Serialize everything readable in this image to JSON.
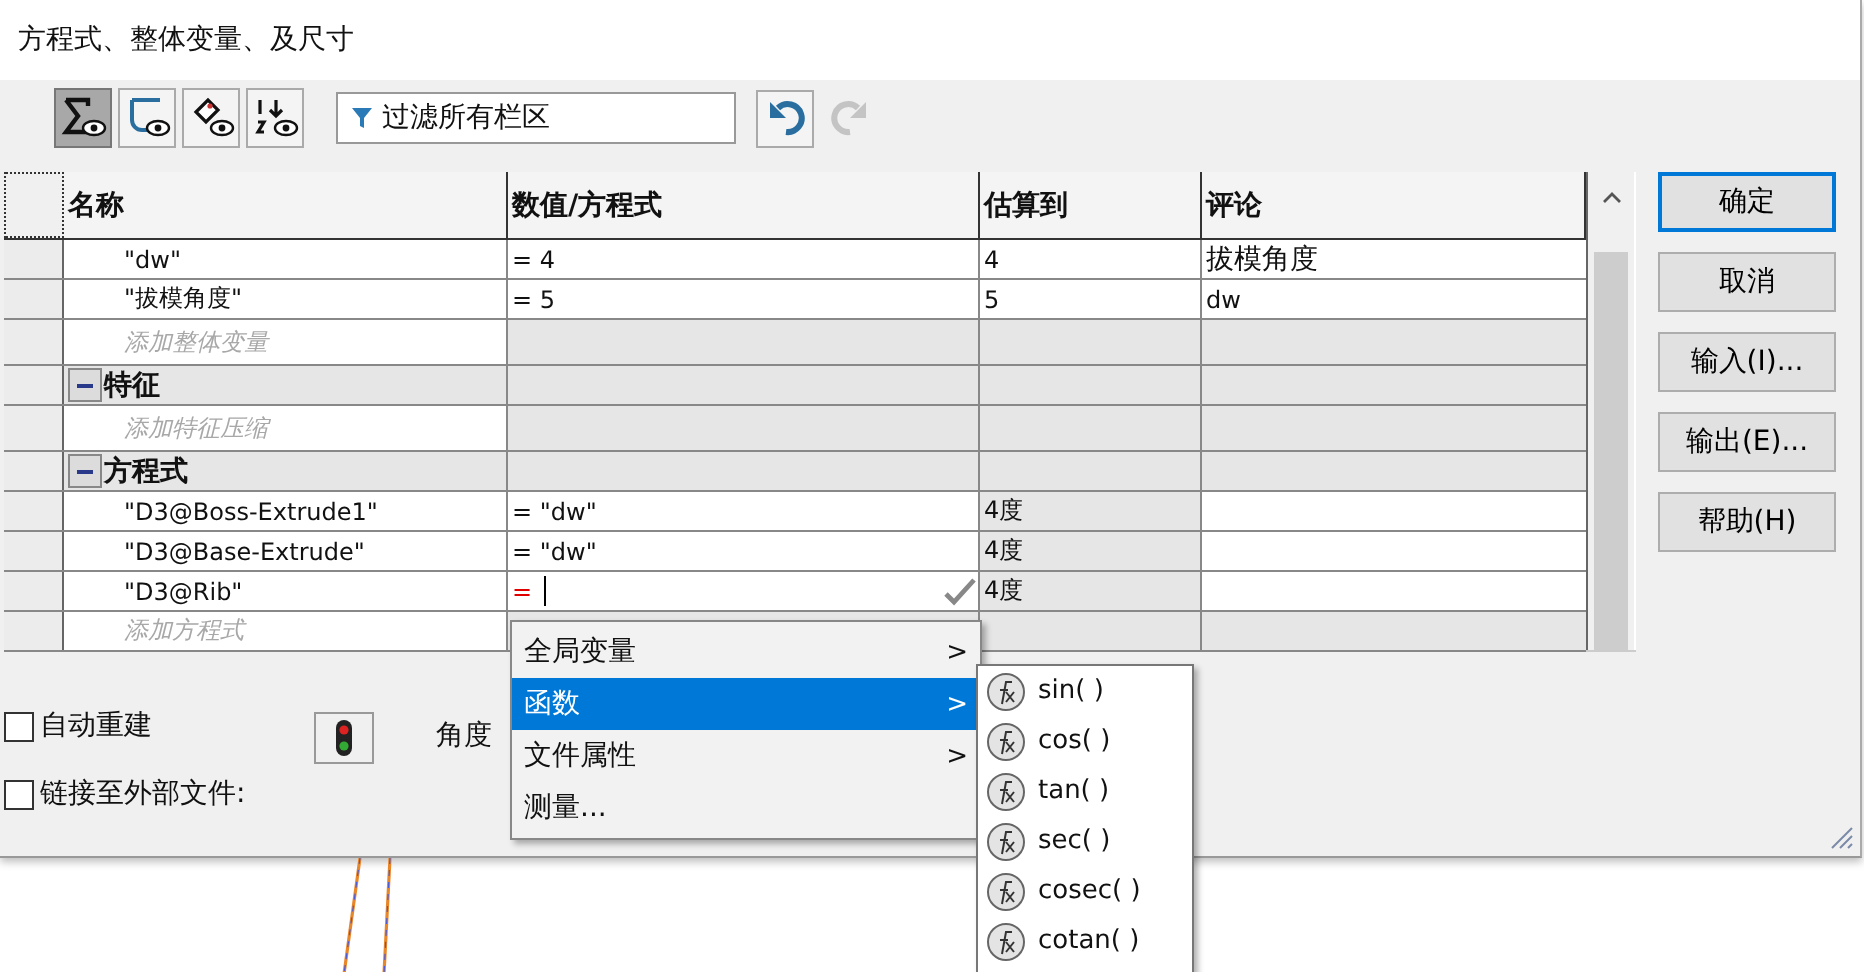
{
  "window": {
    "title": "方程式、整体变量、及尺寸"
  },
  "toolbar": {
    "view_buttons": [
      {
        "kind": "sum",
        "selected": true
      },
      {
        "kind": "sketch",
        "selected": false
      },
      {
        "kind": "tag",
        "selected": false
      },
      {
        "kind": "order",
        "selected": false
      }
    ],
    "filter": {
      "placeholder": "过滤所有栏区"
    },
    "undo_enabled": true,
    "redo_enabled": false
  },
  "table": {
    "columns": [
      "名称",
      "数值/方程式",
      "估算到",
      "评论"
    ],
    "rows": [
      {
        "kind": "var",
        "name": "\"dw\"",
        "value": "= 4",
        "evaluates": "4",
        "comment": "拔模角度"
      },
      {
        "kind": "var",
        "name": "\"拔模角度\"",
        "value": "= 5",
        "evaluates": "5",
        "comment": "dw"
      },
      {
        "kind": "add",
        "name": "添加整体变量"
      },
      {
        "kind": "group",
        "name": "特征",
        "expanded": true
      },
      {
        "kind": "add",
        "name": "添加特征压缩"
      },
      {
        "kind": "group",
        "name": "方程式",
        "expanded": true
      },
      {
        "kind": "eq",
        "name": "\"D3@Boss-Extrude1\"",
        "value": "= \"dw\"",
        "evaluates": "4度"
      },
      {
        "kind": "eq",
        "name": "\"D3@Base-Extrude\"",
        "value": "= \"dw\"",
        "evaluates": "4度"
      },
      {
        "kind": "edit",
        "name": "\"D3@Rib\"",
        "value": "=",
        "evaluates": "4度"
      },
      {
        "kind": "add",
        "name": "添加方程式"
      }
    ]
  },
  "buttons": [
    {
      "label": "确定",
      "default": true
    },
    {
      "label": "取消",
      "default": false
    },
    {
      "label": "输入(I)...",
      "default": false
    },
    {
      "label": "输出(E)...",
      "default": false
    },
    {
      "label": "帮助(H)",
      "default": false
    }
  ],
  "options": [
    {
      "label": "自动重建",
      "checked": false
    },
    {
      "label": "链接至外部文件:",
      "checked": false
    }
  ],
  "angle_label": "角度",
  "menu": [
    {
      "label": "全局变量",
      "submenu": true,
      "selected": false
    },
    {
      "label": "函数",
      "submenu": true,
      "selected": true
    },
    {
      "label": "文件属性",
      "submenu": true,
      "selected": false
    },
    {
      "label": "测量...",
      "submenu": false,
      "selected": false
    }
  ],
  "submenu_arrow": ">",
  "functions": [
    "sin( )",
    "cos( )",
    "tan( )",
    "sec( )",
    "cosec( )",
    "cotan( )"
  ]
}
